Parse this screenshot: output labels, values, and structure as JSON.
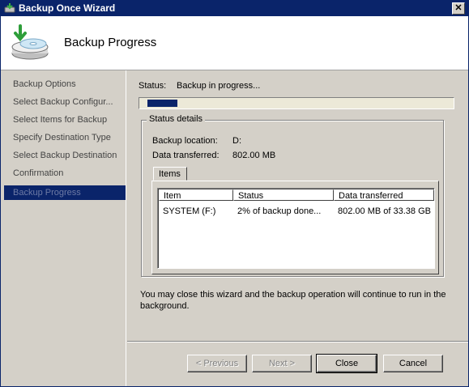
{
  "window": {
    "title": "Backup Once Wizard",
    "close_glyph": "✕"
  },
  "header": {
    "title": "Backup Progress",
    "icon": "backup-drive-icon"
  },
  "nav": {
    "items": [
      {
        "label": "Backup Options",
        "selected": false
      },
      {
        "label": "Select Backup Configur...",
        "selected": false
      },
      {
        "label": "Select Items for Backup",
        "selected": false
      },
      {
        "label": "Specify Destination Type",
        "selected": false
      },
      {
        "label": "Select Backup Destination",
        "selected": false
      },
      {
        "label": "Confirmation",
        "selected": false
      },
      {
        "label": "Backup Progress",
        "selected": true
      }
    ]
  },
  "status": {
    "label": "Status:",
    "value": "Backup in progress...",
    "progress_fraction": 0.1
  },
  "details": {
    "legend": "Status details",
    "location_label": "Backup location:",
    "location_value": "D:",
    "transferred_label": "Data transferred:",
    "transferred_value": "802.00 MB",
    "tab_label": "Items",
    "columns": [
      "Item",
      "Status",
      "Data transferred"
    ],
    "rows": [
      {
        "item": "SYSTEM (F:)",
        "status": "2% of backup done...",
        "transferred": "802.00 MB of 33.38 GB"
      }
    ]
  },
  "note": "You may close this wizard and the backup operation will continue to run in the background.",
  "buttons": {
    "previous": "< Previous",
    "next": "Next >",
    "close": "Close",
    "cancel": "Cancel"
  },
  "colors": {
    "titlebar": "#0a246a",
    "selection": "#0a246a",
    "face": "#d4d0c8"
  }
}
